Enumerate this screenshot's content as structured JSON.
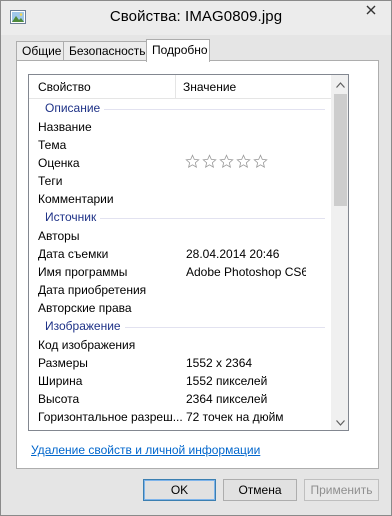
{
  "window": {
    "title": "Свойства: IMAG0809.jpg"
  },
  "tabs": [
    {
      "label": "Общие",
      "active": false
    },
    {
      "label": "Безопасность",
      "active": false
    },
    {
      "label": "Подробно",
      "active": true
    }
  ],
  "list": {
    "columns": [
      "Свойство",
      "Значение"
    ],
    "groups": [
      {
        "name": "Описание",
        "rows": [
          {
            "key": "Название",
            "value": ""
          },
          {
            "key": "Тема",
            "value": ""
          },
          {
            "key": "Оценка",
            "value": "",
            "rating_stars": 5,
            "rating_filled": 0
          },
          {
            "key": "Теги",
            "value": ""
          },
          {
            "key": "Комментарии",
            "value": ""
          }
        ]
      },
      {
        "name": "Источник",
        "rows": [
          {
            "key": "Авторы",
            "value": ""
          },
          {
            "key": "Дата съемки",
            "value": "28.04.2014 20:46"
          },
          {
            "key": "Имя программы",
            "value": "Adobe Photoshop CS6..."
          },
          {
            "key": "Дата приобретения",
            "value": ""
          },
          {
            "key": "Авторские права",
            "value": ""
          }
        ]
      },
      {
        "name": "Изображение",
        "rows": [
          {
            "key": "Код изображения",
            "value": ""
          },
          {
            "key": "Размеры",
            "value": "1552 x 2364"
          },
          {
            "key": "Ширина",
            "value": "1552 пикселей"
          },
          {
            "key": "Высота",
            "value": "2364 пикселей"
          },
          {
            "key": "Горизонтальное разреш...",
            "value": "72 точек на дюйм"
          }
        ]
      }
    ]
  },
  "link": {
    "remove_properties": "Удаление свойств и личной информации"
  },
  "buttons": {
    "ok": "OK",
    "cancel": "Отмена",
    "apply": "Применить"
  },
  "colors": {
    "group_heading": "#1e3287",
    "link": "#0066cc",
    "ok_border": "#3c7fb1"
  }
}
